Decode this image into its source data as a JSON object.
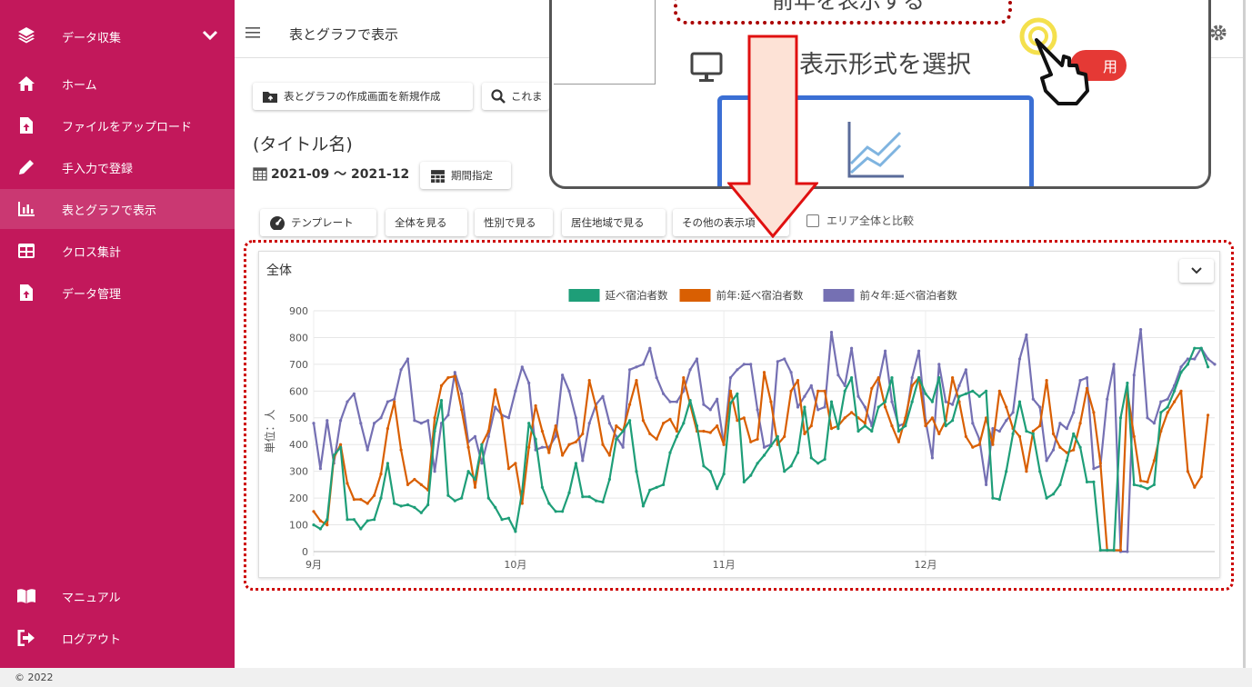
{
  "sidebar": {
    "header_label": "データ収集",
    "items": [
      {
        "label": "ホーム",
        "icon": "home-icon"
      },
      {
        "label": "ファイルをアップロード",
        "icon": "file-upload-icon"
      },
      {
        "label": "手入力で登録",
        "icon": "pencil-icon"
      },
      {
        "label": "表とグラフで表示",
        "icon": "bar-chart-icon",
        "active": true
      },
      {
        "label": "クロス集計",
        "icon": "table-icon"
      },
      {
        "label": "データ管理",
        "icon": "file-upload-icon"
      }
    ],
    "bottom_items": [
      {
        "label": "マニュアル",
        "icon": "book-icon"
      },
      {
        "label": "ログアウト",
        "icon": "logout-icon"
      }
    ],
    "color": "#c2185b"
  },
  "header": {
    "title": "表とグラフで表示"
  },
  "toolbar": {
    "new_label": "表とグラフの作成画面を新規作成",
    "search_label": "これま"
  },
  "page": {
    "title": "(タイトル名)",
    "date_range": "2021-09 ～ 2021-12",
    "period_button": "期間指定"
  },
  "view_tabs": {
    "template": "テンプレート",
    "all": "全体を見る",
    "gender": "性別で見る",
    "region": "居住地域で見る",
    "other": "その他の表示項",
    "area_compare": "エリア全体と比較"
  },
  "card": {
    "title": "全体"
  },
  "overlay": {
    "top_text": "前年を表示する",
    "select_text": "タの表示形式を選択",
    "badge_text": "用"
  },
  "footer": {
    "copyright": "© 2022"
  },
  "chart_data": {
    "type": "line",
    "ylabel": "単位：人",
    "ylim": [
      0,
      900
    ],
    "yticks": [
      0,
      100,
      200,
      300,
      400,
      500,
      600,
      700,
      800,
      900
    ],
    "x_tick_labels": [
      "9月",
      "10月",
      "11月",
      "12月"
    ],
    "x_tick_index": [
      0,
      30,
      61,
      91
    ],
    "series": [
      {
        "name": "延べ宿泊者数",
        "color": "#1e9e78",
        "values": [
          100,
          85,
          120,
          360,
          390,
          120,
          120,
          85,
          115,
          120,
          200,
          330,
          180,
          170,
          175,
          165,
          145,
          175,
          450,
          565,
          210,
          190,
          200,
          300,
          270,
          400,
          200,
          165,
          120,
          125,
          75,
          225,
          480,
          420,
          240,
          180,
          150,
          150,
          220,
          330,
          205,
          205,
          190,
          185,
          270,
          420,
          450,
          490,
          300,
          170,
          230,
          240,
          250,
          370,
          430,
          480,
          565,
          470,
          320,
          300,
          235,
          290,
          555,
          590,
          260,
          285,
          330,
          360,
          395,
          430,
          300,
          320,
          370,
          540,
          350,
          330,
          345,
          560,
          460,
          600,
          650,
          450,
          470,
          450,
          540,
          560,
          650,
          450,
          470,
          560,
          650,
          590,
          560,
          650,
          470,
          490,
          580,
          590,
          600,
          580,
          600,
          200,
          195,
          300,
          440,
          560,
          450,
          440,
          300,
          200,
          215,
          250,
          340,
          440,
          390,
          260,
          260,
          5,
          5,
          5,
          500,
          630,
          250,
          245,
          235,
          250,
          520,
          540,
          600,
          670,
          700,
          760,
          760,
          690
        ]
      },
      {
        "name": "前年:延べ宿泊者数",
        "color": "#d95f02",
        "values": [
          150,
          115,
          100,
          350,
          400,
          255,
          195,
          195,
          180,
          210,
          290,
          460,
          560,
          380,
          250,
          270,
          250,
          230,
          500,
          620,
          650,
          655,
          530,
          390,
          240,
          400,
          450,
          605,
          500,
          310,
          330,
          180,
          390,
          545,
          450,
          370,
          470,
          360,
          400,
          410,
          440,
          640,
          540,
          400,
          360,
          470,
          450,
          550,
          640,
          490,
          440,
          420,
          480,
          495,
          450,
          650,
          550,
          450,
          450,
          445,
          470,
          400,
          600,
          490,
          500,
          410,
          420,
          670,
          560,
          400,
          430,
          600,
          640,
          440,
          470,
          600,
          600,
          460,
          470,
          500,
          520,
          500,
          480,
          610,
          650,
          540,
          470,
          410,
          500,
          620,
          650,
          470,
          500,
          440,
          490,
          650,
          560,
          430,
          390,
          400,
          500,
          400,
          600,
          540,
          460,
          430,
          300,
          450,
          470,
          640,
          440,
          390,
          370,
          380,
          480,
          610,
          520,
          330,
          5,
          5,
          5,
          600,
          430,
          265,
          260,
          340,
          450,
          520,
          560,
          600,
          300,
          240,
          280,
          510
        ]
      },
      {
        "name": "前々年:延べ宿泊者数",
        "color": "#7570b3",
        "values": [
          480,
          310,
          490,
          330,
          490,
          560,
          590,
          480,
          380,
          480,
          500,
          560,
          570,
          680,
          720,
          490,
          480,
          490,
          300,
          480,
          510,
          670,
          590,
          410,
          430,
          330,
          430,
          540,
          510,
          500,
          600,
          690,
          630,
          380,
          390,
          390,
          430,
          660,
          600,
          500,
          340,
          480,
          550,
          580,
          480,
          430,
          390,
          680,
          690,
          700,
          760,
          650,
          590,
          560,
          560,
          600,
          680,
          720,
          550,
          530,
          570,
          400,
          650,
          680,
          700,
          700,
          530,
          390,
          400,
          710,
          720,
          670,
          540,
          580,
          620,
          530,
          540,
          820,
          660,
          620,
          760,
          580,
          540,
          470,
          630,
          750,
          560,
          470,
          480,
          650,
          750,
          490,
          350,
          700,
          560,
          550,
          620,
          680,
          480,
          420,
          250,
          460,
          450,
          490,
          520,
          720,
          810,
          570,
          540,
          340,
          380,
          480,
          460,
          520,
          640,
          650,
          310,
          320,
          570,
          700,
          0,
          0,
          660,
          830,
          500,
          480,
          560,
          570,
          620,
          690,
          720,
          720,
          760,
          720,
          700
        ]
      }
    ],
    "legend": "top-center",
    "grid": true
  }
}
